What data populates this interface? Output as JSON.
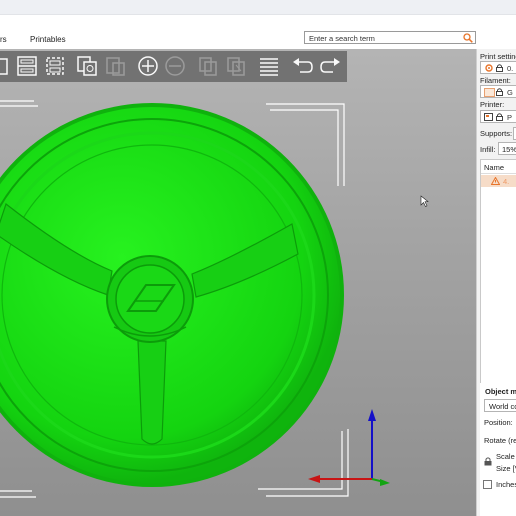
{
  "menu": {
    "item_partial": "rs",
    "printables": "Printables"
  },
  "search": {
    "placeholder": "Enter a search term"
  },
  "toolbar": {
    "icons": [
      "add-part-icon",
      "arrange-icon",
      "arrange-selection-icon",
      "copy-icon",
      "paste-icon",
      "add-instance-icon",
      "remove-instance-icon",
      "split-objects-icon",
      "split-parts-icon",
      "layers-editing-icon",
      "undo-icon",
      "redo-icon"
    ]
  },
  "sidebar": {
    "print_settings_label": "Print setting",
    "print_profile_value": "0.",
    "filament_label": "Filament:",
    "filament_value": "G",
    "printer_label": "Printer:",
    "printer_value": "P",
    "supports_label": "Supports:",
    "infill_label": "Infill:",
    "infill_value": "15%",
    "list_header_name": "Name",
    "list_item_text": "4.",
    "object_manipulation_title": "Object m",
    "coord_select_value": "World co",
    "position_label": "Position:",
    "rotate_label": "Rotate (re",
    "scale_label": "Scale f",
    "size_label": "Size [V",
    "inches_label": "Inches"
  },
  "colors": {
    "model": "#1ee81a",
    "accent": "#e8742a",
    "warning": "#e8742a"
  }
}
